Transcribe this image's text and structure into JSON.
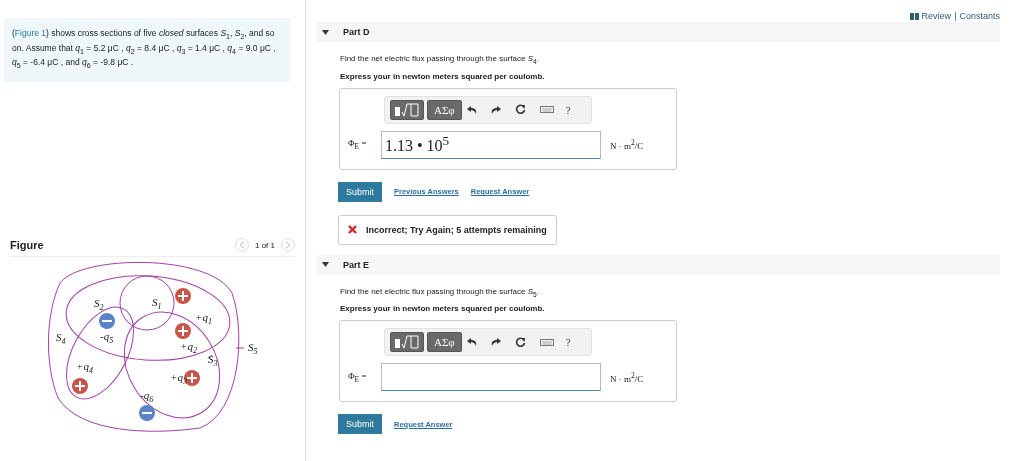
{
  "header": {
    "links": [
      "Review",
      "Constants"
    ],
    "separator": "|"
  },
  "intro": {
    "before": "(",
    "link": "Figure 1",
    "after": ") shows cross sections of five *closed* surfaces *S*$_{1}$, *S*$_{2}$, and so on. Assume that *q*$_{1}$ = 5.2 μC , *q*$_{2}$ = 8.4 μC , *q*$_{3}$ = 1.4 μC , *q*$_{4}$ = 9.0 μC , *q*$_{5}$ = -6.4 μC , and *q*$_{6}$ = -9.8 μC ."
  },
  "figure": {
    "title": "Figure",
    "pager": "1 of 1",
    "labels": [
      {
        "base": "S",
        "sub": "1"
      },
      {
        "base": "S",
        "sub": "2"
      },
      {
        "base": "S",
        "sub": "3"
      },
      {
        "base": "S",
        "sub": "4"
      },
      {
        "base": "S",
        "sub": "5"
      },
      {
        "base": "+q",
        "sub": "1"
      },
      {
        "base": "+q",
        "sub": "2"
      },
      {
        "base": "+q",
        "sub": "3"
      },
      {
        "base": "+q",
        "sub": "4"
      },
      {
        "base": "-q",
        "sub": "5"
      },
      {
        "base": "-q",
        "sub": "6"
      }
    ],
    "charges": [
      {
        "kind": "positive"
      },
      {
        "kind": "positive"
      },
      {
        "kind": "positive"
      },
      {
        "kind": "positive"
      },
      {
        "kind": "negative"
      },
      {
        "kind": "negative"
      }
    ]
  },
  "parts": [
    {
      "title": "Part D",
      "expanded": true,
      "prompt": "Find the net electric flux passing through the surface *S*$_{4}$.",
      "instruction": "Express your in newton meters squared per coulomb.",
      "toolbar": {
        "symbols": "ΑΣφ",
        "help": "?"
      },
      "label": "Φ$_{E}$ =",
      "value": "1.13 • 10$^{5}$",
      "unit": "N · m$^{2}$/C",
      "submit": "Submit",
      "links": [
        "Previous Answers",
        "Request Answer"
      ],
      "feedback": {
        "kind": "incorrect",
        "text": "Incorrect; Try Again; 5 attempts remaining"
      }
    },
    {
      "title": "Part E",
      "expanded": true,
      "prompt": "Find the net electric flux passing through the surface *S*$_{5}$.",
      "instruction": "Express your in newton meters squared per coulomb.",
      "toolbar": {
        "symbols": "ΑΣφ",
        "help": "?"
      },
      "label": "Φ$_{E}$ =",
      "unit": "N · m$^{2}$/C",
      "submit": "Submit",
      "links": [
        "Request Answer"
      ]
    }
  ]
}
